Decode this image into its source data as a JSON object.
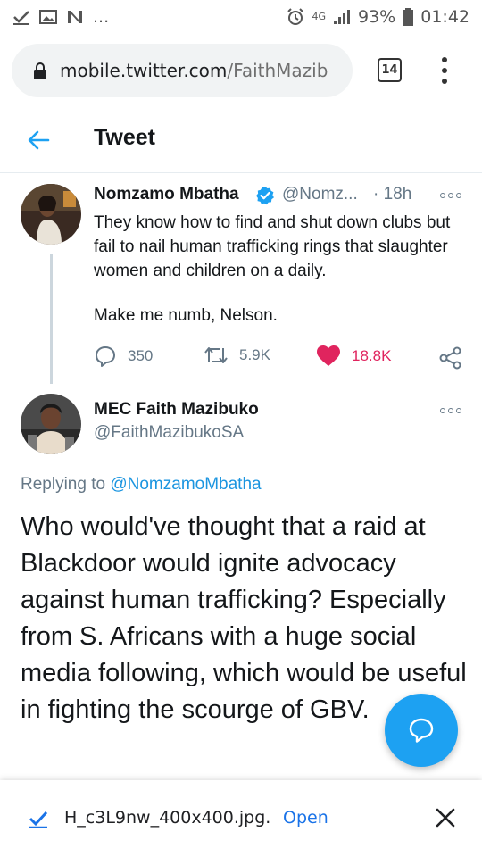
{
  "status_bar": {
    "notification_icons": [
      "check-icon",
      "image-icon",
      "n-icon"
    ],
    "more_indicator": "...",
    "network": "4G",
    "battery": "93%",
    "time": "01:42"
  },
  "browser": {
    "url_host": "mobile.twitter.com",
    "url_path": "/FaithMazib",
    "tab_count": "14"
  },
  "header": {
    "title": "Tweet"
  },
  "parent_tweet": {
    "author_name": "Nomzamo Mbatha",
    "handle": "@Nomz...",
    "time": "· 18h",
    "text": "They know how to find and shut down clubs but fail to nail human trafficking rings that slaughter women and children on a daily.",
    "text_line2": "Make me numb, Nelson.",
    "replies": "350",
    "retweets": "5.9K",
    "likes": "18.8K"
  },
  "reply_tweet": {
    "author_name": "MEC Faith Mazibuko",
    "handle": "@FaithMazibukoSA",
    "replying_prefix": "Replying to",
    "replying_to": "@NomzamoMbatha",
    "text": "Who would've thought that a raid at Blackdoor would ignite advocacy against human trafficking? Especially from S. Africans with a huge social media following, which would be useful in fighting the scourge of GBV."
  },
  "download_bar": {
    "filename": "H_c3L9nw_400x400.jpg.",
    "open_label": "Open"
  },
  "colors": {
    "twitter_blue": "#1da1f2",
    "like_red": "#e0245e",
    "muted_text": "#657786",
    "link_blue": "#1a73e8"
  }
}
